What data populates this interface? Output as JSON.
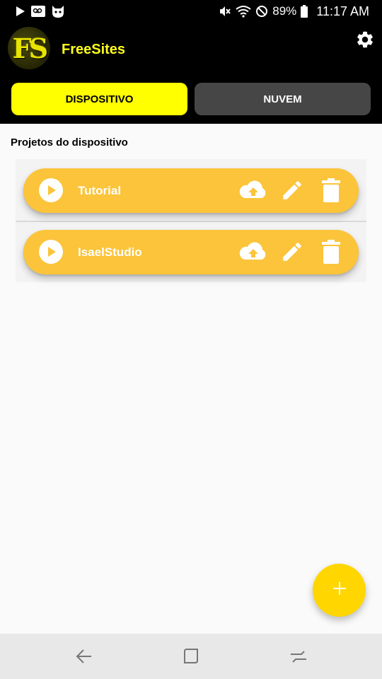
{
  "status_bar": {
    "battery_percent": "89%",
    "time": "11:17 AM",
    "icons": [
      "play-store-icon",
      "voicemail-icon",
      "cat-app-icon",
      "mute-icon",
      "wifi-icon",
      "do-not-disturb-icon",
      "battery-icon"
    ]
  },
  "header": {
    "logo_text": "FS",
    "app_title": "FreeSites",
    "settings_icon": "gear-icon"
  },
  "tabs": [
    {
      "label": "DISPOSITIVO",
      "active": true
    },
    {
      "label": "NUVEM",
      "active": false
    }
  ],
  "section_title": "Projetos do dispositivo",
  "projects": [
    {
      "name": "Tutorial"
    },
    {
      "name": "IsaelStudio"
    }
  ],
  "fab": {
    "icon": "plus-icon"
  },
  "colors": {
    "accent_yellow": "#ffff00",
    "card_yellow": "#fbc43a",
    "fab_yellow": "#ffd600",
    "header_bg": "#000000",
    "inactive_tab": "#464646"
  },
  "nav_bar": {
    "icons": [
      "back-icon",
      "recents-icon",
      "home-icon"
    ]
  }
}
